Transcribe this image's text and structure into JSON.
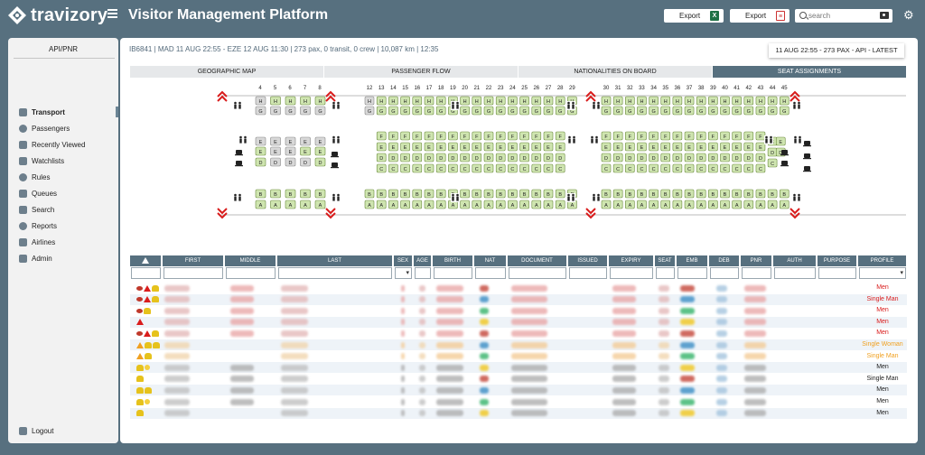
{
  "app": {
    "brand": "travizory",
    "title": "Visitor Management Platform"
  },
  "toolbar": {
    "export1_label": "Export",
    "export2_label": "Export",
    "search_placeholder": "search"
  },
  "sidebar": {
    "title": "API/PNR",
    "items": [
      {
        "label": "Transport",
        "name": "transport",
        "active": true
      },
      {
        "label": "Passengers",
        "name": "passengers"
      },
      {
        "label": "Recently Viewed",
        "name": "recently-viewed"
      },
      {
        "label": "Watchlists",
        "name": "watchlists"
      },
      {
        "label": "Rules",
        "name": "rules"
      },
      {
        "label": "Queues",
        "name": "queues"
      },
      {
        "label": "Search",
        "name": "search"
      },
      {
        "label": "Reports",
        "name": "reports"
      },
      {
        "label": "Airlines",
        "name": "airlines"
      },
      {
        "label": "Admin",
        "name": "admin"
      }
    ],
    "logout": "Logout"
  },
  "flight": {
    "info": "IB6841  |  MAD 11 AUG 22:55 - EZE 12 AUG 11:30  |  273 pax, 0 transit, 0 crew  |  10,087 km  |  12:35",
    "badge": "11 AUG 22:55 - 273 PAX - API - LATEST"
  },
  "tabs": [
    {
      "label": "GEOGRAPHIC MAP",
      "name": "tab-geographic-map"
    },
    {
      "label": "PASSENGER FLOW",
      "name": "tab-passenger-flow"
    },
    {
      "label": "NATIONALITIES ON BOARD",
      "name": "tab-nationalities"
    },
    {
      "label": "SEAT ASSIGNMENTS",
      "name": "tab-seat-assignments",
      "active": true
    }
  ],
  "seatmap": {
    "row_numbers": [
      "4",
      "5",
      "6",
      "7",
      "8",
      "12",
      "13",
      "14",
      "15",
      "16",
      "17",
      "18",
      "19",
      "20",
      "21",
      "22",
      "23",
      "24",
      "25",
      "26",
      "27",
      "28",
      "29",
      "30",
      "31",
      "32",
      "33",
      "34",
      "35",
      "36",
      "37",
      "38",
      "39",
      "40",
      "41",
      "42",
      "43",
      "44",
      "45"
    ],
    "letters": [
      "H",
      "G",
      "F",
      "E",
      "D",
      "C",
      "B",
      "A"
    ]
  },
  "table": {
    "headers": [
      "FIRST",
      "MIDDLE",
      "LAST",
      "SEX",
      "AGE",
      "BIRTH",
      "NAT",
      "DOCUMENT",
      "ISSUED",
      "EXPIRY",
      "SEAT",
      "EMB",
      "DEB",
      "PNR",
      "AUTH",
      "PURPOSE",
      "PROFILE"
    ],
    "rows": [
      {
        "flags": [
          "eye",
          "warn",
          "ppl"
        ],
        "tone": "red",
        "middle": true,
        "profile": "Men",
        "profile_color": "#d91c1c"
      },
      {
        "flags": [
          "eye",
          "warn",
          "ppl"
        ],
        "tone": "red",
        "middle": true,
        "profile": "Single Man",
        "profile_color": "#d91c1c"
      },
      {
        "flags": [
          "eye",
          "ppl"
        ],
        "tone": "red",
        "middle": true,
        "profile": "Men",
        "profile_color": "#d91c1c"
      },
      {
        "flags": [
          "warn"
        ],
        "tone": "red",
        "middle": true,
        "profile": "Men",
        "profile_color": "#d91c1c"
      },
      {
        "flags": [
          "eye",
          "warn",
          "ppl"
        ],
        "tone": "red",
        "middle": true,
        "profile": "Men",
        "profile_color": "#d91c1c"
      },
      {
        "flags": [
          "warnO",
          "ppl",
          "ppl"
        ],
        "tone": "orange",
        "middle": false,
        "profile": "Single Woman",
        "profile_color": "#f0a020"
      },
      {
        "flags": [
          "warnO",
          "ppl"
        ],
        "tone": "orange",
        "middle": false,
        "profile": "Single Man",
        "profile_color": "#f0a020"
      },
      {
        "flags": [
          "ppl",
          "dot"
        ],
        "tone": "gray",
        "middle": true,
        "profile": "Men",
        "profile_color": "#222222"
      },
      {
        "flags": [
          "ppl"
        ],
        "tone": "gray",
        "middle": true,
        "profile": "Single Man",
        "profile_color": "#222222"
      },
      {
        "flags": [
          "ppl",
          "ppl"
        ],
        "tone": "gray",
        "middle": true,
        "profile": "Men",
        "profile_color": "#222222"
      },
      {
        "flags": [
          "ppl",
          "dot"
        ],
        "tone": "gray",
        "middle": true,
        "profile": "Men",
        "profile_color": "#222222"
      },
      {
        "flags": [
          "ppl"
        ],
        "tone": "gray",
        "middle": false,
        "profile": "Men",
        "profile_color": "#222222"
      }
    ]
  }
}
